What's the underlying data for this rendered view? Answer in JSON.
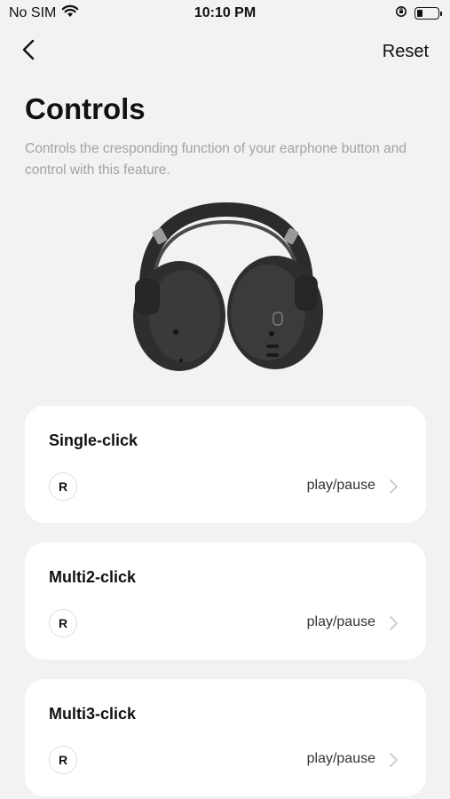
{
  "status_bar": {
    "carrier": "No SIM",
    "time": "10:10 PM",
    "icons": [
      "wifi-icon",
      "rotation-lock-icon",
      "battery-icon"
    ],
    "battery_level": 0.25
  },
  "nav": {
    "back_icon": "chevron-left-icon",
    "reset_label": "Reset"
  },
  "page": {
    "title": "Controls",
    "description": "Controls the cresponding function of your earphone button and control with this feature."
  },
  "controls": [
    {
      "title": "Single-click",
      "side": "R",
      "action": "play/pause"
    },
    {
      "title": "Multi2-click",
      "side": "R",
      "action": "play/pause"
    },
    {
      "title": "Multi3-click",
      "side": "R",
      "action": "play/pause"
    }
  ],
  "colors": {
    "background": "#f2f2f2",
    "card": "#ffffff",
    "description_text": "#a3a3a3",
    "chevron": "#c8c8c8"
  }
}
